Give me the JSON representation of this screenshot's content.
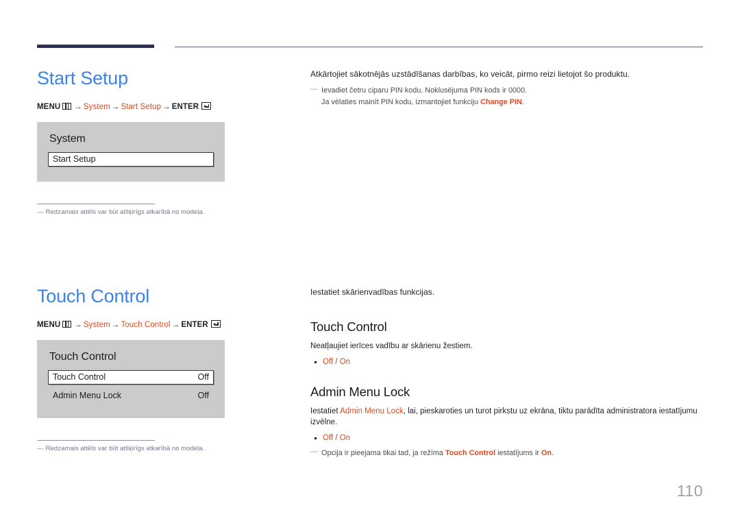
{
  "header": {
    "rule_color_thick": "#2b3252",
    "rule_color_thin": "#5d5f78"
  },
  "colors": {
    "title_blue": "#3d82e8",
    "accent_red": "#e0471e",
    "osd_bg": "#cbcbcb",
    "note_gray": "#73758c"
  },
  "sections": [
    {
      "title": "Start Setup",
      "menu_path": {
        "menu_label": "MENU",
        "menu_icon": "menu-grid-icon",
        "arrow": "→",
        "steps": [
          "System",
          "Start Setup"
        ],
        "enter_label": "ENTER",
        "enter_icon": "enter-return-icon"
      },
      "osd": {
        "title": "System",
        "rows": [
          {
            "label": "Start Setup",
            "value": "",
            "selected": true
          }
        ]
      },
      "footnote": {
        "dash": "―",
        "text": "Redzamais attēls var būt atšķirīgs atkarībā no modeļa."
      },
      "right": {
        "intro": "Atkārtojiet sākotnējās uzstādīšanas darbības, ko veicāt, pirmo reizi lietojot šo produktu.",
        "note": {
          "dash": "―",
          "line1": "Ievadiet četru ciparu PIN kodu. Noklusējuma PIN kods ir 0000.",
          "line2_pre": "Ja vēlaties mainīt PIN kodu, izmantojiet funkciju ",
          "line2_hl": "Change PIN",
          "line2_post": "."
        }
      }
    },
    {
      "title": "Touch Control",
      "menu_path": {
        "menu_label": "MENU",
        "menu_icon": "menu-grid-icon",
        "arrow": "→",
        "steps": [
          "System",
          "Touch Control"
        ],
        "enter_label": "ENTER",
        "enter_icon": "enter-return-icon"
      },
      "osd": {
        "title": "Touch Control",
        "rows": [
          {
            "label": "Touch Control",
            "value": "Off",
            "selected": true
          },
          {
            "label": "Admin Menu Lock",
            "value": "Off",
            "selected": false
          }
        ]
      },
      "footnote": {
        "dash": "―",
        "text": "Redzamais attēls var būt atšķirīgs atkarībā no modeļa."
      },
      "right": {
        "intro": "Iestatiet skārienvadības funkcijas.",
        "sub1": {
          "title": "Touch Control",
          "desc": "Neatļaujiet ierīces vadību ar skārienu žestiem.",
          "options": {
            "off": "Off",
            "sep": " / ",
            "on": "On"
          }
        },
        "sub2": {
          "title": "Admin Menu Lock",
          "desc_pre": "Iestatiet ",
          "desc_hl": "Admin Menu Lock",
          "desc_post": ", lai, pieskaroties un turot pirkstu uz ekrāna, tiktu parādīta administratora iestatījumu izvēlne.",
          "options": {
            "off": "Off",
            "sep": " / ",
            "on": "On"
          },
          "note": {
            "dash": "―",
            "pre": "Opcija ir pieejama tikai tad, ja režīma ",
            "hl1": "Touch Control",
            "mid": " iestatījums ir ",
            "hl2": "On",
            "post": "."
          }
        }
      }
    }
  ],
  "page_number": "110"
}
